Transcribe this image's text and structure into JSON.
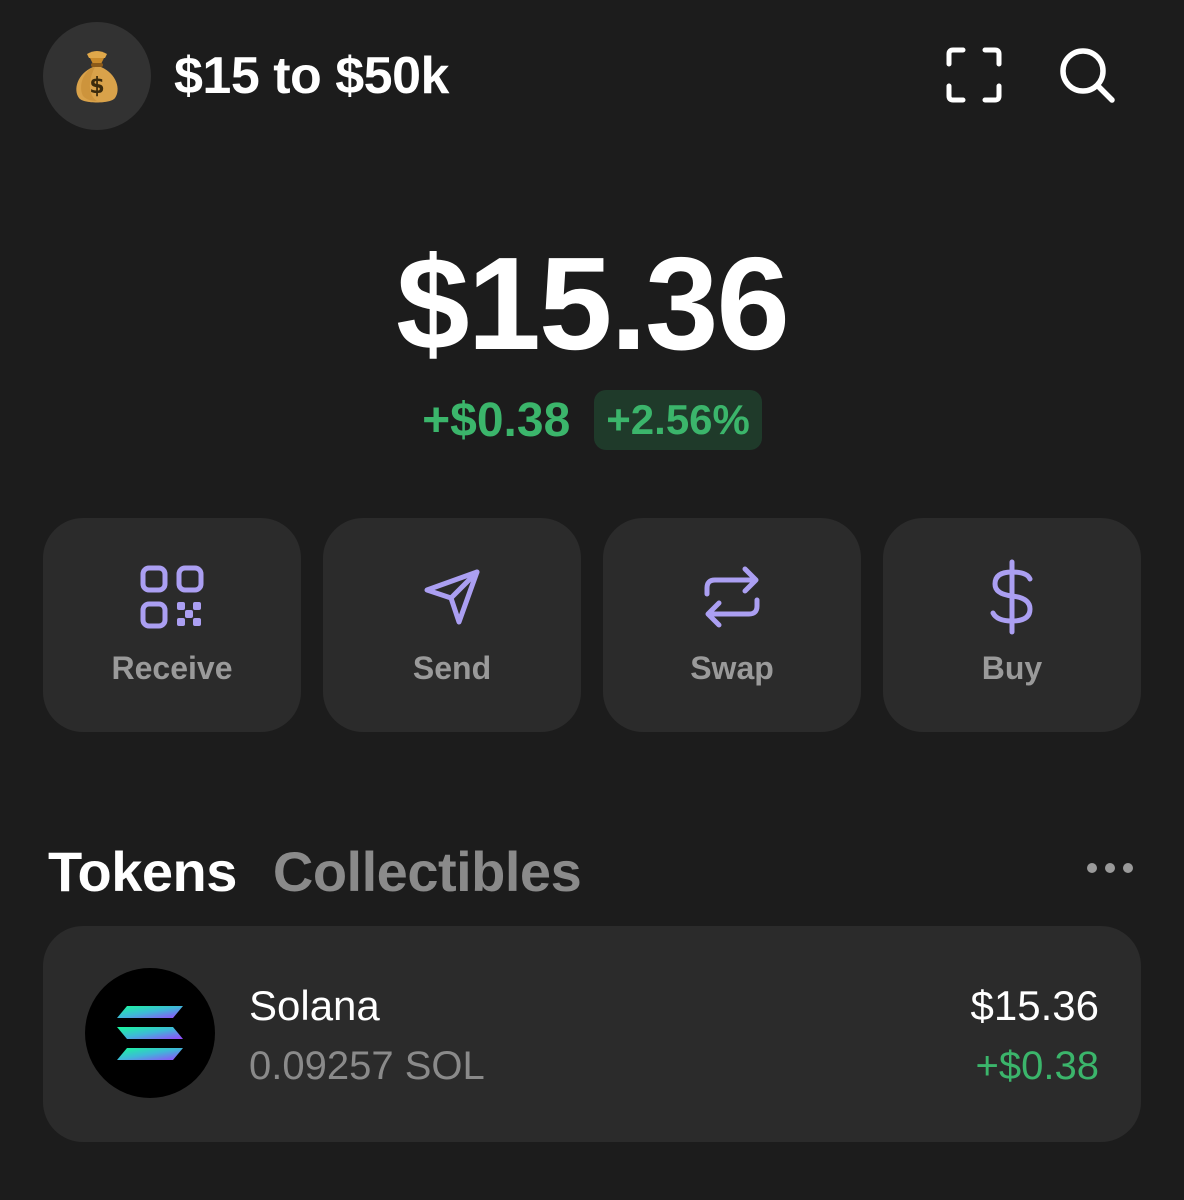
{
  "header": {
    "avatar_emoji": "💰",
    "title": "$15 to $50k",
    "scan_icon": "scan-icon",
    "search_icon": "search-icon"
  },
  "balance": {
    "total": "$15.36",
    "change_abs": "+$0.38",
    "change_pct": "+2.56%"
  },
  "actions": [
    {
      "label": "Receive",
      "icon": "qr-code-icon"
    },
    {
      "label": "Send",
      "icon": "send-icon"
    },
    {
      "label": "Swap",
      "icon": "swap-icon"
    },
    {
      "label": "Buy",
      "icon": "dollar-icon"
    }
  ],
  "tabs": {
    "tokens": "Tokens",
    "collectibles": "Collectibles",
    "active": "Tokens"
  },
  "tokens": [
    {
      "name": "Solana",
      "amount": "0.09257 SOL",
      "value": "$15.36",
      "change": "+$0.38",
      "icon": "solana-logo-icon"
    }
  ],
  "colors": {
    "background": "#1c1c1c",
    "card": "#2b2b2b",
    "accent": "#ab9ff2",
    "positive": "#3bb56b",
    "positive_bg": "#1f3a2a",
    "muted_text": "#9a9a9a"
  }
}
